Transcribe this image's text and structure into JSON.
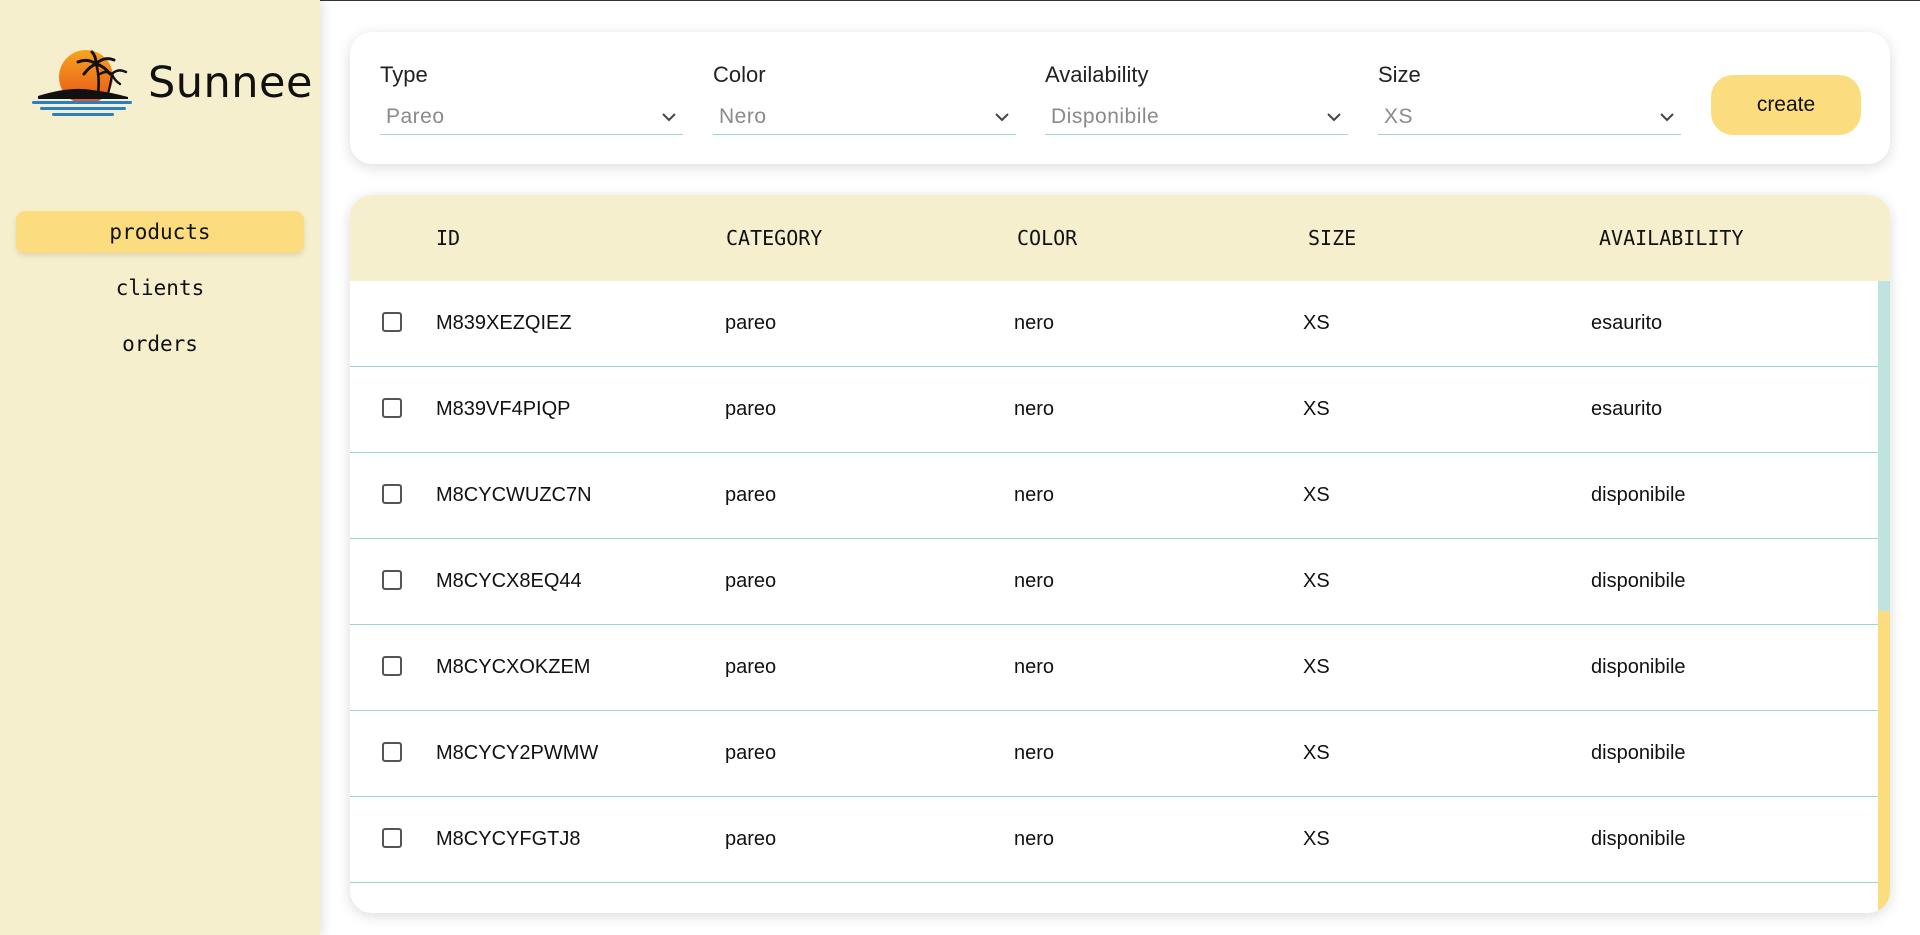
{
  "brand": {
    "name": "Sunnee",
    "logo_icon": "sunset-island-palm-icon"
  },
  "nav": {
    "items": [
      {
        "label": "products",
        "active": true
      },
      {
        "label": "clients",
        "active": false
      },
      {
        "label": "orders",
        "active": false
      }
    ]
  },
  "filters": {
    "type": {
      "label": "Type",
      "value": "Pareo"
    },
    "color": {
      "label": "Color",
      "value": "Nero"
    },
    "availability": {
      "label": "Availability",
      "value": "Disponibile"
    },
    "size": {
      "label": "Size",
      "value": "XS"
    },
    "create_label": "create"
  },
  "table": {
    "headers": [
      "ID",
      "CATEGORY",
      "COLOR",
      "SIZE",
      "AVAILABILITY"
    ],
    "rows": [
      {
        "id": "M839XEZQIEZ",
        "category": "pareo",
        "color": "nero",
        "size": "XS",
        "availability": "esaurito"
      },
      {
        "id": "M839VF4PIQP",
        "category": "pareo",
        "color": "nero",
        "size": "XS",
        "availability": "esaurito"
      },
      {
        "id": "M8CYCWUZC7N",
        "category": "pareo",
        "color": "nero",
        "size": "XS",
        "availability": "disponibile"
      },
      {
        "id": "M8CYCX8EQ44",
        "category": "pareo",
        "color": "nero",
        "size": "XS",
        "availability": "disponibile"
      },
      {
        "id": "M8CYCXOKZEM",
        "category": "pareo",
        "color": "nero",
        "size": "XS",
        "availability": "disponibile"
      },
      {
        "id": "M8CYCY2PWMW",
        "category": "pareo",
        "color": "nero",
        "size": "XS",
        "availability": "disponibile"
      },
      {
        "id": "M8CYCYFGTJ8",
        "category": "pareo",
        "color": "nero",
        "size": "XS",
        "availability": "disponibile"
      }
    ]
  },
  "colors": {
    "sidebar_bg": "#f6efcd",
    "accent": "#fbdc7e",
    "divider": "#9ed4cf"
  }
}
